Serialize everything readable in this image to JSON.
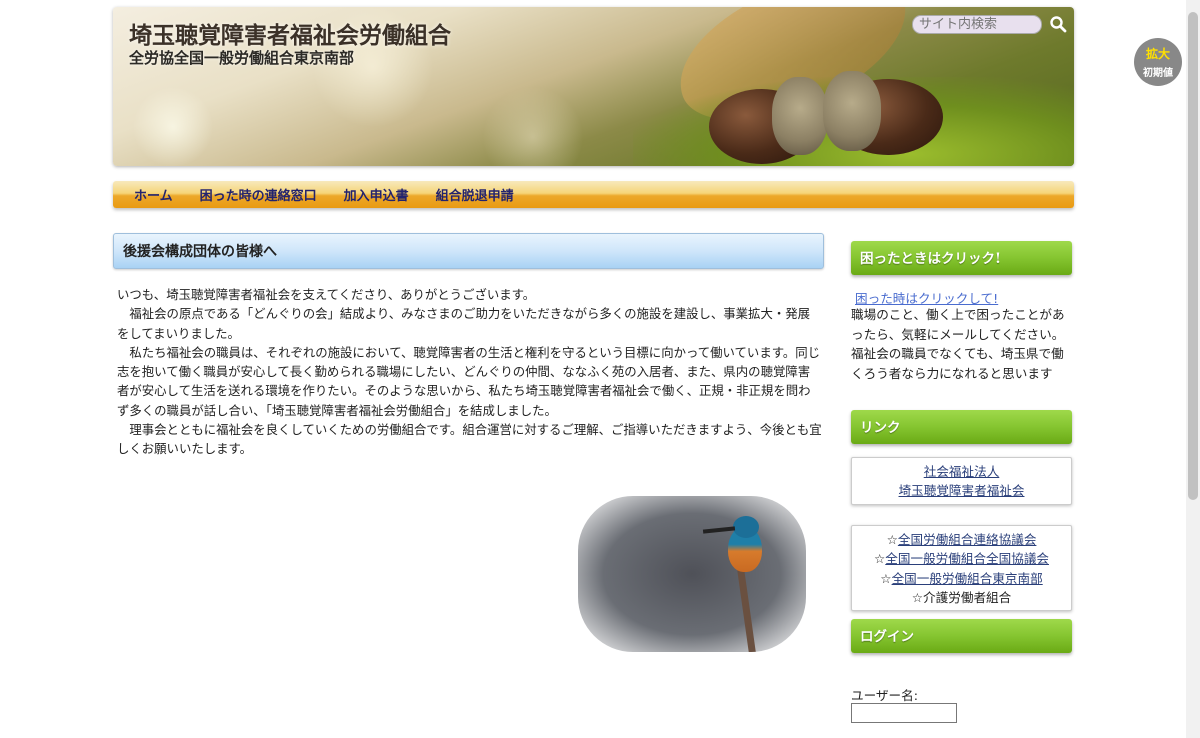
{
  "header": {
    "site_title": "埼玉聴覚障害者福祉会労働組合",
    "site_subtitle": "全労協全国一般労働組合東京南部",
    "search_placeholder": "サイト内検索"
  },
  "zoom": {
    "enlarge_label": "拡大",
    "reset_label": "初期値"
  },
  "nav": {
    "items": [
      {
        "label": "ホーム"
      },
      {
        "label": "困った時の連絡窓口"
      },
      {
        "label": "加入申込書"
      },
      {
        "label": "組合脱退申請"
      }
    ]
  },
  "main": {
    "heading": "後援会構成団体の皆様へ",
    "paragraphs": [
      "いつも、埼玉聴覚障害者福祉会を支えてくださり、ありがとうございます。",
      "福祉会の原点である「どんぐりの会」結成より、みなさまのご助力をいただきながら多くの施設を建設し、事業拡大・発展をしてまいりました。",
      "私たち福祉会の職員は、それぞれの施設において、聴覚障害者の生活と権利を守るという目標に向かって働いています。同じ志を抱いて働く職員が安心して長く勤められる職場にしたい、どんぐりの仲間、ななふく苑の入居者、また、県内の聴覚障害者が安心して生活を送れる環境を作りたい。そのような思いから、私たち埼玉聴覚障害者福祉会で働く、正規・非正規を問わず多くの職員が話し合い、「埼玉聴覚障害者福祉会労働組合」を結成しました。",
      "理事会とともに福祉会を良くしていくための労働組合です。組合運営に対するご理解、ご指導いただきますよう、今後とも宜しくお願いいたします。"
    ]
  },
  "sidebar": {
    "help": {
      "heading": "困ったときはクリック!",
      "link": "困った時はクリックして!",
      "text": "職場のこと、働く上で困ったことがあったら、気軽にメールしてください。福祉会の職員でなくても、埼玉県で働くろう者なら力になれると思います"
    },
    "links": {
      "heading": "リンク",
      "box1": [
        "社会福祉法人",
        "埼玉聴覚障害者福祉会"
      ],
      "box2": [
        {
          "prefix": "☆",
          "label": "全国労働組合連絡協議会"
        },
        {
          "prefix": "☆",
          "label": "全国一般労働組合全国協議会"
        },
        {
          "prefix": "☆",
          "label": "全国一般労働組合東京南部"
        },
        {
          "prefix": "☆",
          "label": "介護労働者組合"
        }
      ]
    },
    "login": {
      "heading": "ログイン",
      "username_label": "ユーザー名:",
      "username_value": ""
    }
  }
}
